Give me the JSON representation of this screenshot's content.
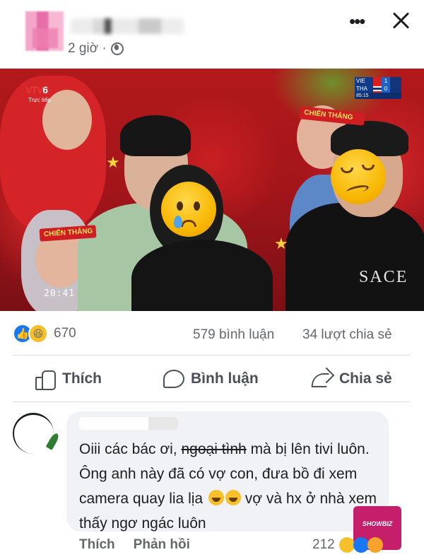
{
  "post": {
    "time": "2 giờ ·",
    "photo": {
      "channel_logo_part1": "VTV",
      "channel_logo_part2": "6",
      "channel_sub": "Trực tiếp",
      "headband_text": "CHIẾN THẮNG",
      "video_time": "20:41",
      "shirt_text": "SACE",
      "scoreboard": {
        "team1": "VIE",
        "score1": "1",
        "team2": "THA",
        "score2": "0",
        "match_time": "85:15"
      }
    }
  },
  "stats": {
    "reaction_count": "670",
    "comments": "579 bình luận",
    "shares": "34 lượt chia sẻ"
  },
  "actions": {
    "like": "Thích",
    "comment": "Bình luận",
    "share": "Chia sẻ"
  },
  "comment": {
    "text_before": "Oiii các bác ơi, ",
    "text_strike": "ngoại tình",
    "text_middle": " mà bị lên tivi luôn. Ông anh này đã có vợ con, đưa bồ đi xem camera quay lia lịa ",
    "text_after": " vợ và hx ở nhà xem thấy ngơ ngác luôn",
    "like_label": "Thích",
    "reply_label": "Phản hồi",
    "reaction_count": "212"
  },
  "watermark": "SHOWBIZ",
  "colors": {
    "facebook_blue": "#1877f2",
    "text_secondary": "#65676b",
    "bubble_bg": "#f0f2f5"
  },
  "icons": [
    "more-icon",
    "close-icon",
    "globe-icon",
    "thumb-icon",
    "comment-bubble-icon",
    "share-icon"
  ]
}
